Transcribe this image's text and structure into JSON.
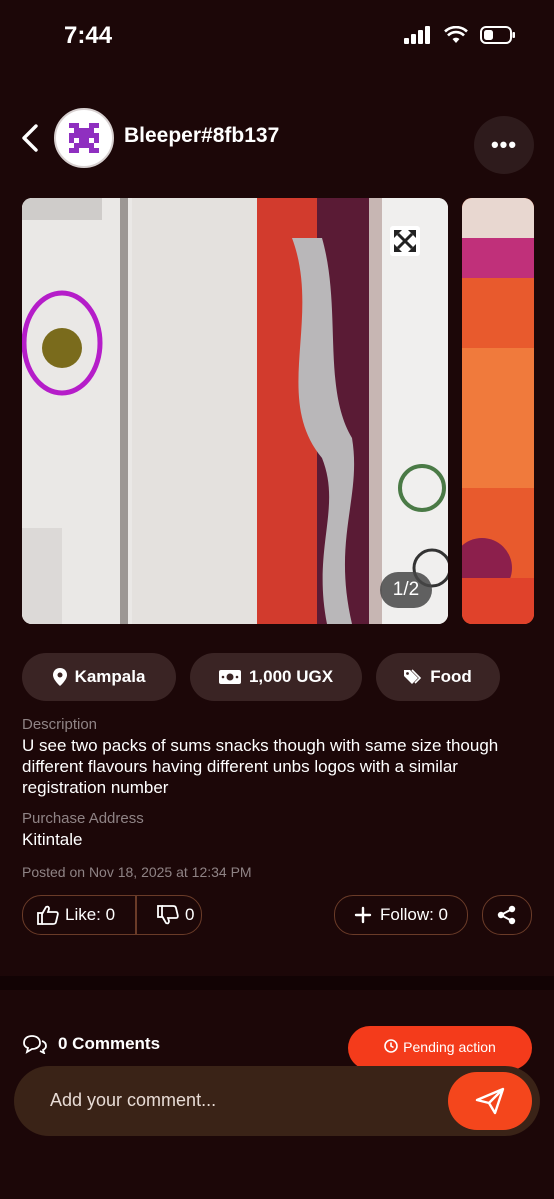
{
  "status_bar": {
    "time": "7:44"
  },
  "header": {
    "username": "Bleeper#8fb137"
  },
  "gallery": {
    "counter": "1/2"
  },
  "chips": {
    "location": "Kampala",
    "price": "1,000 UGX",
    "category": "Food"
  },
  "description": {
    "label": "Description",
    "text": "U see two packs of sums snacks though with same size though different flavours having different unbs logos with a similar registration number"
  },
  "purchase": {
    "label": "Purchase Address",
    "value": "Kitintale"
  },
  "posted": "Posted on Nov 18, 2025 at 12:34 PM",
  "actions": {
    "like": "Like: 0",
    "dislike": "0",
    "follow": "Follow: 0"
  },
  "comments": {
    "title": "0 Comments",
    "pending": "Pending action",
    "placeholder": "Add your comment..."
  },
  "colors": {
    "background": "#1c0708",
    "accent": "#f4461c",
    "chip": "#3a2424"
  }
}
